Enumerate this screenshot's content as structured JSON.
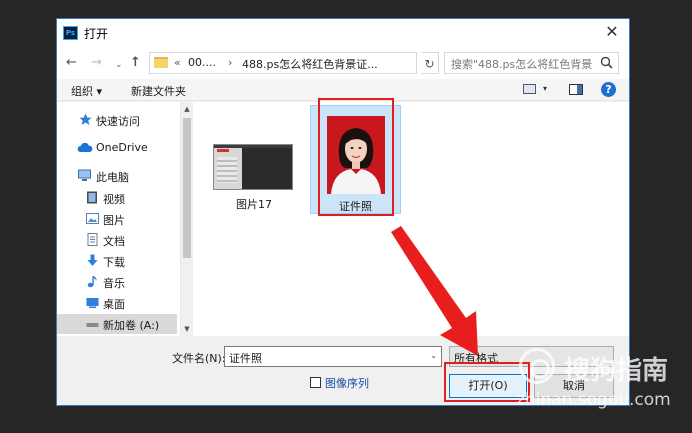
{
  "window": {
    "app_icon": "Ps",
    "title": "打开",
    "close_glyph": "✕"
  },
  "address_bar": {
    "back_glyph": "←",
    "forward_glyph": "→",
    "recent_glyph": "⌄",
    "up_glyph": "↑",
    "separator": "«",
    "crumbs": [
      "00....",
      "488.ps怎么将红色背景证..."
    ],
    "crumb_separator": "›",
    "dropdown_glyph": "⌄",
    "refresh_glyph": "↻",
    "search_placeholder": "搜索\"488.ps怎么将红色背景..."
  },
  "toolbar": {
    "organize_label": "组织 ▾",
    "new_folder_label": "新建文件夹",
    "view_dropdown_glyph": "▾",
    "help_glyph": "?"
  },
  "nav": {
    "items": [
      {
        "label": "快速访问",
        "icon": "star-icon"
      },
      {
        "label": "OneDrive",
        "icon": "cloud-icon"
      },
      {
        "label": "此电脑",
        "icon": "computer-icon"
      },
      {
        "label": "视频",
        "icon": "video-icon"
      },
      {
        "label": "图片",
        "icon": "picture-icon"
      },
      {
        "label": "文档",
        "icon": "document-icon"
      },
      {
        "label": "下载",
        "icon": "download-icon"
      },
      {
        "label": "音乐",
        "icon": "music-icon"
      },
      {
        "label": "桌面",
        "icon": "desktop-icon"
      },
      {
        "label": "新加卷 (A:)",
        "icon": "drive-icon"
      }
    ],
    "scroll_up_glyph": "▲",
    "scroll_down_glyph": "▼"
  },
  "files": [
    {
      "name": "图片17"
    },
    {
      "name": "证件照"
    }
  ],
  "bottom": {
    "filename_label": "文件名(N):",
    "filename_value": "证件照",
    "filename_dropdown_glyph": "⌄",
    "file_type_value": "所有格式",
    "image_sequence_label": "图像序列",
    "open_label": "打开(O)",
    "cancel_label": "取消"
  },
  "watermark": {
    "cn": "搜狗指南",
    "en": "zhinan.sogou.com"
  },
  "colors": {
    "highlight_red": "#e02020",
    "selection": "#cce4f7",
    "accent": "#0078d7",
    "photo_bg": "#c8181e"
  }
}
